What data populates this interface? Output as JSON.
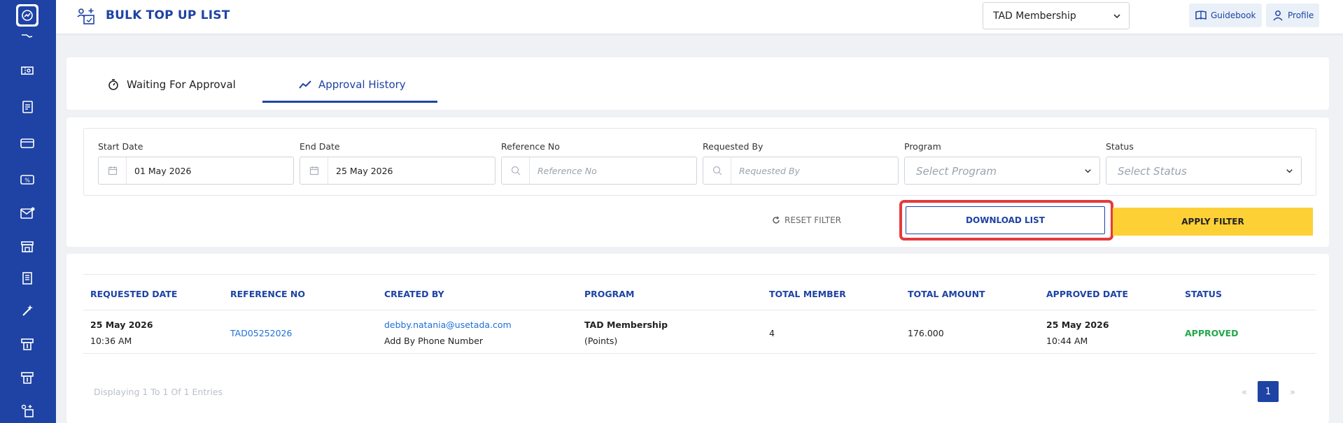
{
  "header": {
    "title": "BULK TOP UP LIST",
    "program_select": "TAD Membership",
    "guidebook_label": "Guidebook",
    "profile_label": "Profile"
  },
  "sidebar": {
    "icons": [
      "hand-icon",
      "ticket-icon",
      "document-icon",
      "card-icon",
      "voucher-icon",
      "mail-icon",
      "store-icon",
      "receipt-icon",
      "magic-wand-icon",
      "top-up-icon",
      "top-up-icon",
      "bulk-top-up-icon"
    ]
  },
  "tabs": [
    {
      "label": "Waiting For Approval",
      "icon": "timer-icon",
      "active": false
    },
    {
      "label": "Approval History",
      "icon": "trend-icon",
      "active": true
    }
  ],
  "filters": {
    "start_date": {
      "label": "Start Date",
      "value": "01 May 2026"
    },
    "end_date": {
      "label": "End Date",
      "value": "25 May 2026"
    },
    "reference_no": {
      "label": "Reference No",
      "placeholder": "Reference No"
    },
    "requested_by": {
      "label": "Requested By",
      "placeholder": "Requested By"
    },
    "program": {
      "label": "Program",
      "placeholder": "Select Program"
    },
    "status": {
      "label": "Status",
      "placeholder": "Select Status"
    }
  },
  "actions": {
    "reset": "RESET FILTER",
    "download": "DOWNLOAD LIST",
    "apply": "APPLY FILTER"
  },
  "table": {
    "columns": [
      "REQUESTED DATE",
      "REFERENCE NO",
      "CREATED BY",
      "PROGRAM",
      "TOTAL MEMBER",
      "TOTAL AMOUNT",
      "APPROVED DATE",
      "STATUS"
    ],
    "rows": [
      {
        "requested_date": "25 May 2026",
        "requested_time": "10:36 AM",
        "reference_no": "TAD05252026",
        "created_by_email": "debby.natania@usetada.com",
        "created_by_method": "Add By Phone Number",
        "program_name": "TAD Membership",
        "program_type": "(Points)",
        "total_member": "4",
        "total_amount": "176.000",
        "approved_date": "25 May 2026",
        "approved_time": "10:44 AM",
        "status": "APPROVED"
      }
    ]
  },
  "pagination": {
    "info": "Displaying 1 To 1 Of 1 Entries",
    "prev": "«",
    "page": "1",
    "next": "»"
  },
  "colors": {
    "primary": "#1e43a4",
    "accent_yellow": "#fdd036",
    "highlight_red": "#e53a3a",
    "status_green": "#23a84a"
  }
}
